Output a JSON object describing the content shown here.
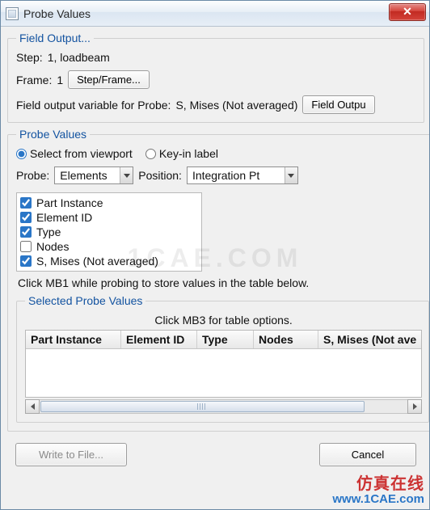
{
  "window": {
    "title": "Probe Values"
  },
  "field_output": {
    "legend": "Field Output...",
    "step_label": "Step:",
    "step_value": "1, loadbeam",
    "frame_label": "Frame:",
    "frame_value": "1",
    "step_frame_btn": "Step/Frame...",
    "variable_label": "Field output variable for Probe:",
    "variable_value": "S, Mises (Not averaged)",
    "field_output_btn": "Field Outpu"
  },
  "probe_values": {
    "legend": "Probe Values",
    "mode_viewport": "Select from viewport",
    "mode_keyin": "Key-in label",
    "probe_label": "Probe:",
    "probe_value": "Elements",
    "position_label": "Position:",
    "position_value": "Integration Pt",
    "columns": [
      {
        "label": "Part Instance",
        "checked": true
      },
      {
        "label": "Element ID",
        "checked": true
      },
      {
        "label": "Type",
        "checked": true
      },
      {
        "label": "Nodes",
        "checked": false
      },
      {
        "label": "S, Mises (Not averaged)",
        "checked": true
      }
    ],
    "hint": "Click MB1 while probing to store values in the table below."
  },
  "selected": {
    "legend": "Selected Probe Values",
    "table_hint": "Click MB3 for table options.",
    "headers": [
      "Part Instance",
      "Element ID",
      "Type",
      "Nodes",
      "S, Mises (Not ave"
    ]
  },
  "footer": {
    "write_btn": "Write to File...",
    "cancel_btn": "Cancel"
  },
  "watermark": {
    "center": "1CAE.COM",
    "line1": "仿真在线",
    "line2": "www.1CAE.com"
  }
}
